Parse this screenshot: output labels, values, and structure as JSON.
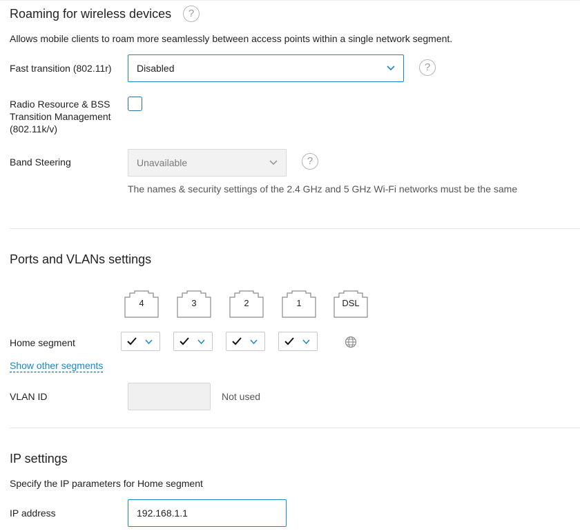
{
  "roaming": {
    "title": "Roaming for wireless devices",
    "description": "Allows mobile clients to roam more seamlessly between access points within a single network segment.",
    "fast_transition": {
      "label": "Fast transition (802.11r)",
      "value": "Disabled",
      "help_icon": "question-circle-icon"
    },
    "rrm_bss": {
      "label_line1": "Radio Resource & BSS",
      "label_line2": "Transition Management",
      "label_line3": "(802.11k/v)",
      "checked": false
    },
    "band_steering": {
      "label": "Band Steering",
      "value": "Unavailable",
      "hint": "The names & security settings of the 2.4 GHz and 5 GHz Wi-Fi networks must be the same",
      "help_icon": "question-circle-icon"
    }
  },
  "ports": {
    "title": "Ports and VLANs settings",
    "port_labels": [
      "4",
      "3",
      "2",
      "1",
      "DSL"
    ],
    "home_segment": {
      "label": "Home segment",
      "selections": [
        "included",
        "included",
        "included",
        "included"
      ],
      "dsl_icon": "globe-icon"
    },
    "show_other_segments": "Show other segments",
    "vlan": {
      "label": "VLAN ID",
      "value": "",
      "status": "Not used"
    }
  },
  "ip": {
    "title": "IP settings",
    "description": "Specify the IP parameters for Home segment",
    "address_label": "IP address",
    "address_value": "192.168.1.1"
  },
  "colors": {
    "accent": "#1a86c6",
    "text": "#222222",
    "muted": "#7a7a7a"
  }
}
